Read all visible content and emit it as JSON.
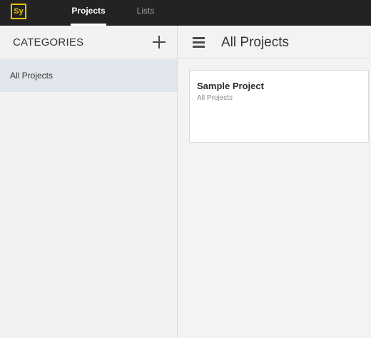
{
  "app": {
    "logo_text": "Sy",
    "brand_color": "#e8c400"
  },
  "tabs": [
    {
      "label": "Projects",
      "active": true
    },
    {
      "label": "Lists",
      "active": false
    }
  ],
  "sidebar": {
    "title": "CATEGORIES",
    "add_icon": "plus-icon",
    "items": [
      {
        "label": "All Projects",
        "selected": true
      }
    ]
  },
  "main": {
    "menu_icon": "hamburger-icon",
    "title": "All Projects",
    "cards": [
      {
        "title": "Sample Project",
        "category": "All Projects"
      }
    ]
  }
}
